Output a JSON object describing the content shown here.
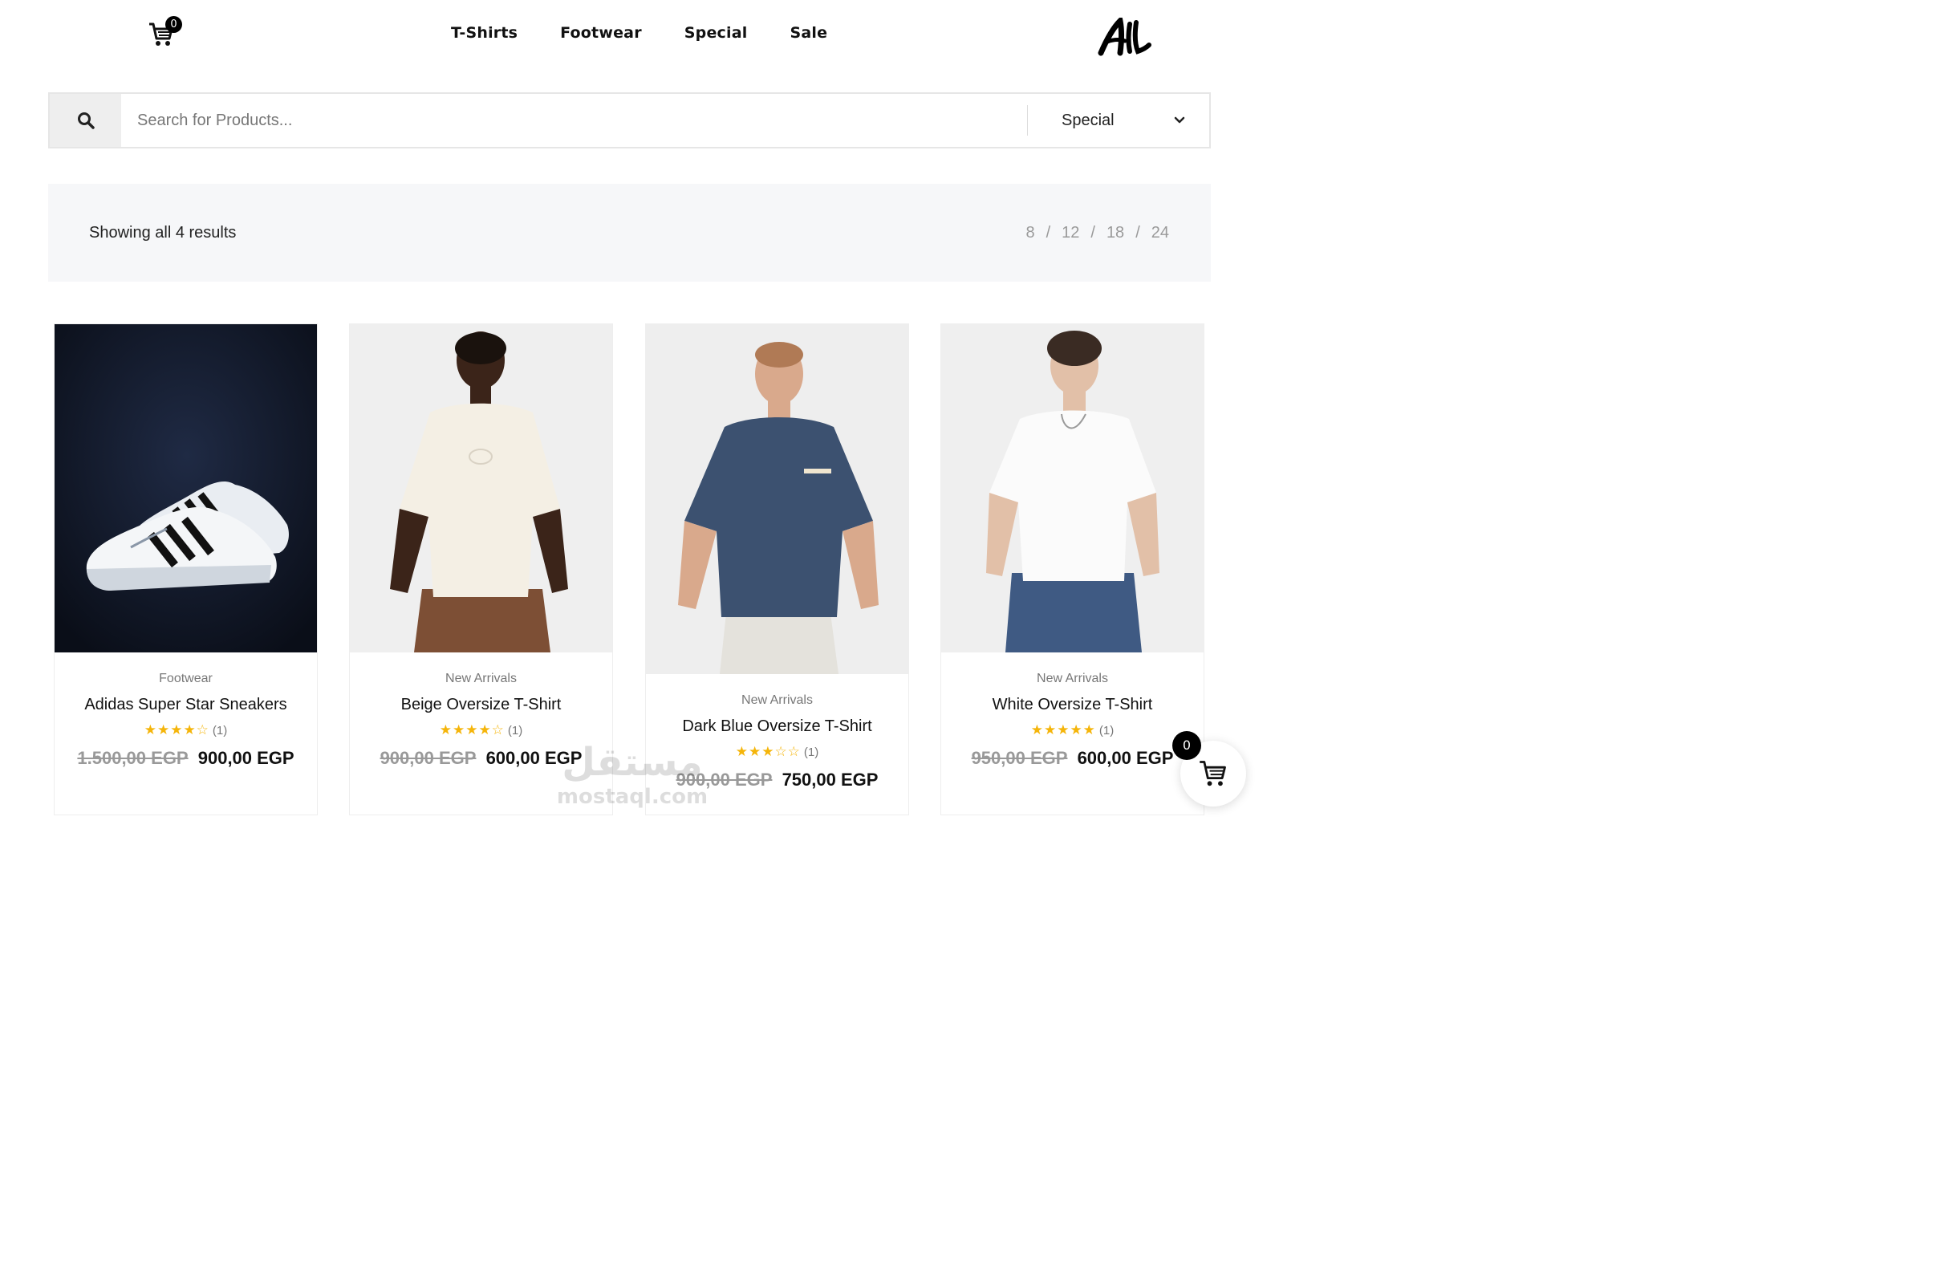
{
  "header": {
    "cart_count": "0",
    "nav": [
      "T-Shirts",
      "Footwear",
      "Special",
      "Sale"
    ],
    "logo_text": "AL"
  },
  "search": {
    "placeholder": "Search for Products...",
    "category_selected": "Special"
  },
  "toolbar": {
    "results_text": "Showing all 4 results",
    "per_page": [
      "8",
      "12",
      "18",
      "24"
    ]
  },
  "products": [
    {
      "category": "Footwear",
      "title": "Adidas Super Star Sneakers",
      "rating": 4,
      "rating_count": "(1)",
      "old_price": "1.500,00 EGP",
      "price": "900,00 EGP",
      "image": "white sneakers with black stripes on dark background"
    },
    {
      "category": "New Arrivals",
      "title": "Beige Oversize T-Shirt",
      "rating": 4,
      "rating_count": "(1)",
      "old_price": "900,00 EGP",
      "price": "600,00 EGP",
      "image": "man in beige oversize t-shirt and brown trousers"
    },
    {
      "category": "New Arrivals",
      "title": "Dark Blue Oversize T-Shirt",
      "rating": 3,
      "rating_count": "(1)",
      "old_price": "900,00 EGP",
      "price": "750,00 EGP",
      "image": "man in dark blue oversize t-shirt and white trousers"
    },
    {
      "category": "New Arrivals",
      "title": "White Oversize T-Shirt",
      "rating": 5,
      "rating_count": "(1)",
      "old_price": "950,00 EGP",
      "price": "600,00 EGP",
      "image": "man in white oversize t-shirt and jeans"
    }
  ],
  "floating_cart": {
    "count": "0"
  },
  "watermark": {
    "arabic": "مستقل",
    "latin": "mostaql.com"
  },
  "colors": {
    "star": "#f5b50a",
    "toolbar_bg": "#f6f7f9",
    "search_btn_bg": "#eeeeee",
    "badge": "#000000"
  }
}
